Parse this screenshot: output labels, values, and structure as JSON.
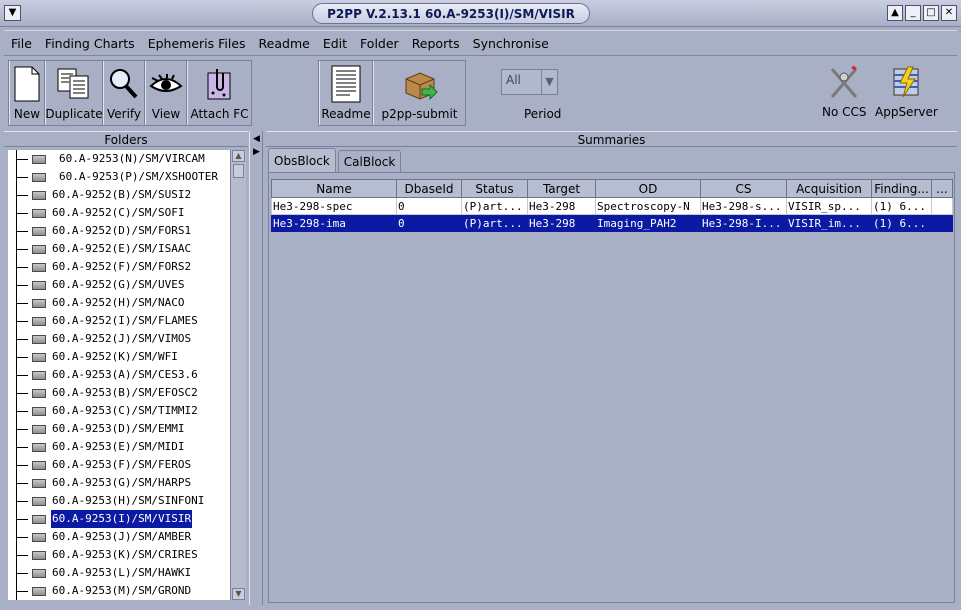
{
  "window": {
    "title": "P2PP V.2.13.1 60.A-9253(I)/SM/VISIR"
  },
  "menu": [
    "File",
    "Finding Charts",
    "Ephemeris Files",
    "Readme",
    "Edit",
    "Folder",
    "Reports",
    "Synchronise"
  ],
  "toolbar": {
    "new": "New",
    "duplicate": "Duplicate",
    "verify": "Verify",
    "view": "View",
    "attach_fc": "Attach FC",
    "readme": "Readme",
    "submit": "p2pp-submit",
    "period_value": "All",
    "period_label": "Period",
    "no_ccs": "No CCS",
    "appserver": "AppServer"
  },
  "folders": {
    "header": "Folders",
    "items": [
      "60.A-9253(N)/SM/VIRCAM",
      "60.A-9253(P)/SM/XSHOOTER",
      "60.A-9252(B)/SM/SUSI2",
      "60.A-9252(C)/SM/SOFI",
      "60.A-9252(D)/SM/FORS1",
      "60.A-9252(E)/SM/ISAAC",
      "60.A-9252(F)/SM/FORS2",
      "60.A-9252(G)/SM/UVES",
      "60.A-9252(H)/SM/NACO",
      "60.A-9252(I)/SM/FLAMES",
      "60.A-9252(J)/SM/VIMOS",
      "60.A-9252(K)/SM/WFI",
      "60.A-9253(A)/SM/CES3.6",
      "60.A-9253(B)/SM/EFOSC2",
      "60.A-9253(C)/SM/TIMMI2",
      "60.A-9253(D)/SM/EMMI",
      "60.A-9253(E)/SM/MIDI",
      "60.A-9253(F)/SM/FEROS",
      "60.A-9253(G)/SM/HARPS",
      "60.A-9253(H)/SM/SINFONI",
      "60.A-9253(I)/SM/VISIR",
      "60.A-9253(J)/SM/AMBER",
      "60.A-9253(K)/SM/CRIRES",
      "60.A-9253(L)/SM/HAWKI",
      "60.A-9253(M)/SM/GROND"
    ],
    "selected_index": 20
  },
  "summaries": {
    "header": "Summaries",
    "tabs": [
      "ObsBlock",
      "CalBlock"
    ],
    "columns": [
      "Name",
      "DbaseId",
      "Status",
      "Target",
      "OD",
      "CS",
      "Acquisition",
      "Finding...",
      "..."
    ],
    "rows": [
      [
        "He3-298-spec",
        "0",
        "(P)art...",
        "He3-298",
        "Spectroscopy-N",
        "He3-298-s...",
        "VISIR_sp...",
        "(1) 6...",
        ""
      ],
      [
        "He3-298-ima",
        "0",
        "(P)art...",
        "He3-298",
        "Imaging_PAH2",
        "He3-298-I...",
        "VISIR_im...",
        "(1) 6...",
        ""
      ]
    ],
    "selected_row": 1
  }
}
